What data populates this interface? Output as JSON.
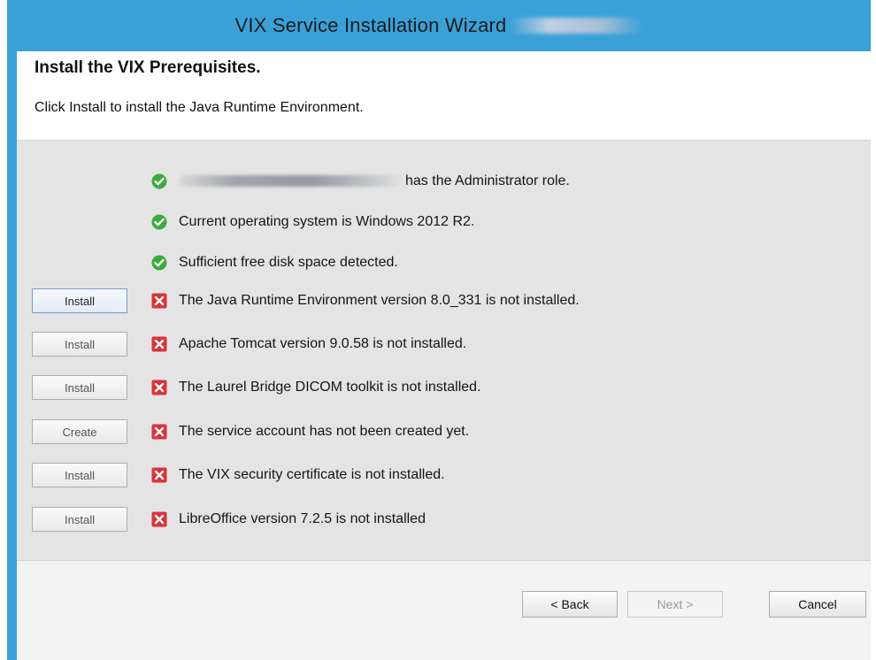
{
  "window": {
    "title": "VIX Service Installation Wizard"
  },
  "header": {
    "title": "Install the VIX Prerequisites.",
    "subtitle": "Click Install to install the Java Runtime Environment."
  },
  "prerequisites": [
    {
      "status": "ok",
      "icon": "green-check-icon",
      "button": null,
      "text": "has the Administrator role."
    },
    {
      "status": "ok",
      "icon": "green-check-icon",
      "button": null,
      "text": "Current operating system is Windows 2012 R2."
    },
    {
      "status": "ok",
      "icon": "green-check-icon",
      "button": null,
      "text": "Sufficient free disk space detected."
    },
    {
      "status": "missing",
      "icon": "red-x-icon",
      "button": "Install",
      "text": "The Java Runtime Environment version 8.0_331 is not installed."
    },
    {
      "status": "missing",
      "icon": "red-x-icon",
      "button": "Install",
      "text": "Apache Tomcat version 9.0.58 is not installed."
    },
    {
      "status": "missing",
      "icon": "red-x-icon",
      "button": "Install",
      "text": "The Laurel Bridge DICOM toolkit is not installed."
    },
    {
      "status": "missing",
      "icon": "red-x-icon",
      "button": "Create",
      "text": "The service account has not been created yet."
    },
    {
      "status": "missing",
      "icon": "red-x-icon",
      "button": "Install",
      "text": "The VIX security certificate is not installed."
    },
    {
      "status": "missing",
      "icon": "red-x-icon",
      "button": "Install",
      "text": "LibreOffice version 7.2.5 is not installed"
    }
  ],
  "footer": {
    "back_label": "< Back",
    "next_label": "Next >",
    "cancel_label": "Cancel"
  },
  "colors": {
    "titlebar": "#3aa1d8",
    "ok": "#3cab3a",
    "missing": "#d8343a"
  }
}
